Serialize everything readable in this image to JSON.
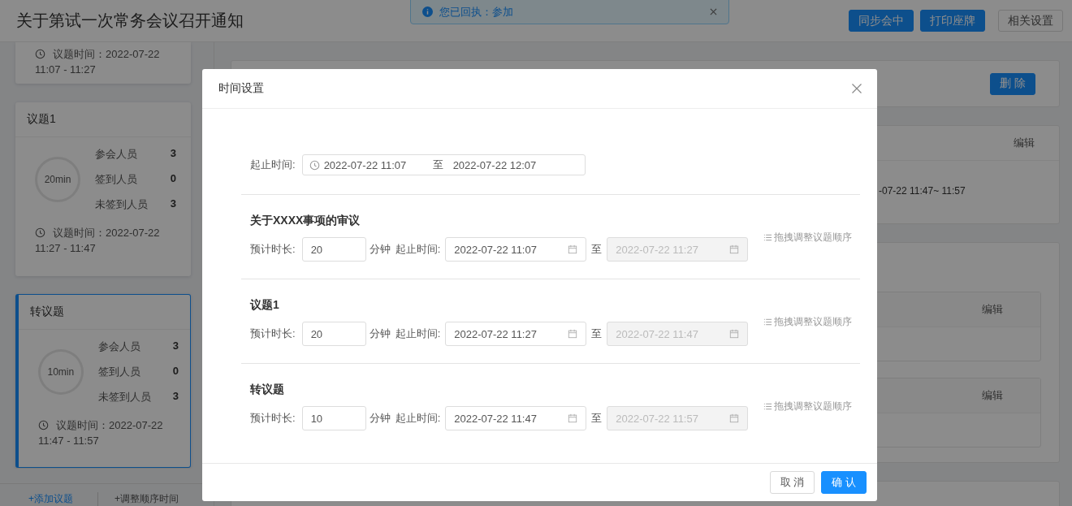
{
  "header": {
    "title": "关于第试一次常务会议召开通知",
    "buttons": [
      {
        "label": "同步会中",
        "kind": "primary"
      },
      {
        "label": "打印座牌",
        "kind": "primary"
      },
      {
        "label": "相关设置",
        "kind": "default"
      }
    ]
  },
  "alert": {
    "text": "您已回执：参加"
  },
  "sidebar": {
    "topics": [
      {
        "kind": "partial",
        "time": "议题时间：2022-07-22",
        "time_range": "11:07 - 11:27",
        "selected": false
      },
      {
        "kind": "full",
        "title": "议题1",
        "duration": "20min",
        "stats": [
          {
            "label": "参会人员",
            "value": "3"
          },
          {
            "label": "签到人员",
            "value": "0"
          },
          {
            "label": "未签到人员",
            "value": "3"
          }
        ],
        "time": "议题时间：2022-07-22",
        "time_range": "11:27 - 11:47",
        "selected": false
      },
      {
        "kind": "full",
        "title": "转议题",
        "duration": "10min",
        "stats": [
          {
            "label": "参会人员",
            "value": "3"
          },
          {
            "label": "签到人员",
            "value": "0"
          },
          {
            "label": "未签到人员",
            "value": "3"
          }
        ],
        "time": "议题时间：2022-07-22",
        "time_range": "11:47 - 11:57",
        "selected": true
      }
    ],
    "links": [
      "+添加议题",
      "+调整顺序时间"
    ]
  },
  "main": {
    "panels": [
      {
        "kind": "toolbar",
        "action": "删 除"
      },
      {
        "kind": "detail",
        "action": "编辑",
        "text": "-07-22 11:47~ 11:57"
      },
      {
        "kind": "group",
        "items": [
          {
            "action": "编辑"
          },
          {
            "action": "编辑"
          }
        ]
      },
      {
        "kind": "empty"
      }
    ]
  },
  "modal": {
    "title": "时间设置",
    "range": {
      "label": "起止时间:",
      "start": "2022-07-22 11:07",
      "separator": "至",
      "end": "2022-07-22 12:07"
    },
    "topics": [
      {
        "title": "关于XXXX事项的审议",
        "duration_label": "预计时长:",
        "duration": "20",
        "unit": "分钟",
        "time_label": "起止时间:",
        "start": {
          "value": "2022-07-22 11:07",
          "disabled": false
        },
        "separator": "至",
        "end": {
          "value": "2022-07-22 11:27",
          "disabled": true
        },
        "drag_hint": "拖拽调整议题顺序"
      },
      {
        "title": "议题1",
        "duration_label": "预计时长:",
        "duration": "20",
        "unit": "分钟",
        "time_label": "起止时间:",
        "start": {
          "value": "2022-07-22 11:27",
          "disabled": false
        },
        "separator": "至",
        "end": {
          "value": "2022-07-22 11:47",
          "disabled": true
        },
        "drag_hint": "拖拽调整议题顺序"
      },
      {
        "title": "转议题",
        "duration_label": "预计时长:",
        "duration": "10",
        "unit": "分钟",
        "time_label": "起止时间:",
        "start": {
          "value": "2022-07-22 11:47",
          "disabled": false
        },
        "separator": "至",
        "end": {
          "value": "2022-07-22 11:57",
          "disabled": true
        },
        "drag_hint": "拖拽调整议题顺序"
      }
    ],
    "buttons": [
      {
        "label": "取 消",
        "kind": "default"
      },
      {
        "label": "确 认",
        "kind": "primary"
      }
    ]
  }
}
